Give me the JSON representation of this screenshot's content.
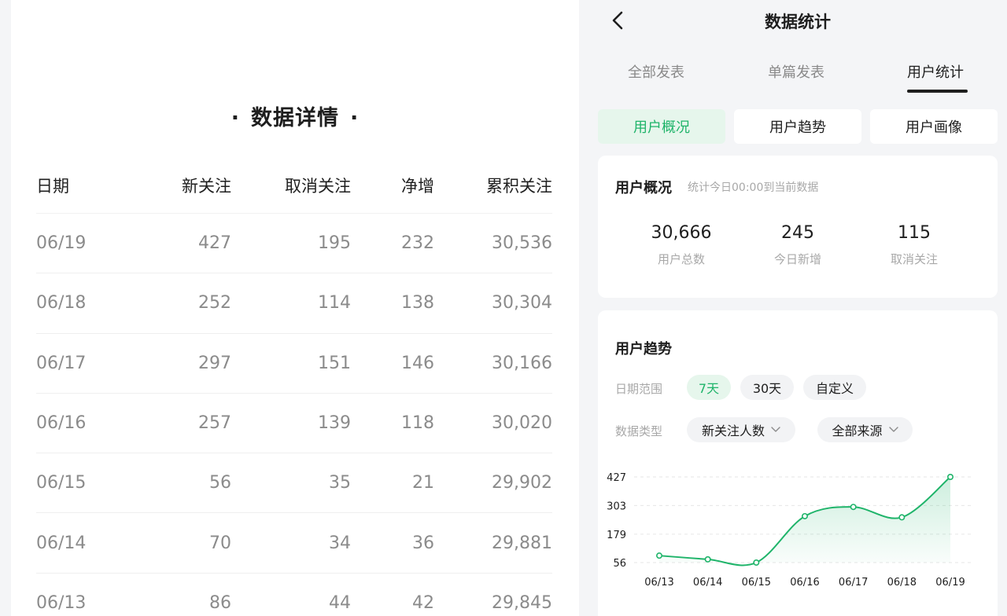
{
  "detail": {
    "title": "数据详情",
    "title_dot": "·",
    "columns": [
      "日期",
      "新关注",
      "取消关注",
      "净增",
      "累积关注"
    ],
    "rows": [
      [
        "06/19",
        "427",
        "195",
        "232",
        "30,536"
      ],
      [
        "06/18",
        "252",
        "114",
        "138",
        "30,304"
      ],
      [
        "06/17",
        "297",
        "151",
        "146",
        "30,166"
      ],
      [
        "06/16",
        "257",
        "139",
        "118",
        "30,020"
      ],
      [
        "06/15",
        "56",
        "35",
        "21",
        "29,902"
      ],
      [
        "06/14",
        "70",
        "34",
        "36",
        "29,881"
      ],
      [
        "06/13",
        "86",
        "44",
        "42",
        "29,845"
      ]
    ]
  },
  "stats": {
    "nav_title": "数据统计",
    "back_icon": "chevron-left-icon",
    "tabs": [
      {
        "label": "全部发表",
        "active": false
      },
      {
        "label": "单篇发表",
        "active": false
      },
      {
        "label": "用户统计",
        "active": true
      }
    ],
    "subtabs": [
      {
        "label": "用户概况",
        "active": true
      },
      {
        "label": "用户趋势",
        "active": false
      },
      {
        "label": "用户画像",
        "active": false
      }
    ],
    "overview": {
      "title": "用户概况",
      "hint": "统计今日00:00到当前数据",
      "items": [
        {
          "value": "30,666",
          "label": "用户总数"
        },
        {
          "value": "245",
          "label": "今日新增"
        },
        {
          "value": "115",
          "label": "取消关注"
        }
      ]
    },
    "trend": {
      "title": "用户趋势",
      "date_range_label": "日期范围",
      "date_options": [
        {
          "label": "7天",
          "active": true
        },
        {
          "label": "30天",
          "active": false
        },
        {
          "label": "自定义",
          "active": false
        }
      ],
      "data_type_label": "数据类型",
      "data_type_value": "新关注人数",
      "source_value": "全部来源",
      "dropdown_icon": "chevron-down-icon"
    },
    "accent_color": "#1fb46a",
    "accent_bg": "#e6f6ec"
  },
  "chart_data": {
    "type": "area",
    "categories": [
      "06/13",
      "06/14",
      "06/15",
      "06/16",
      "06/17",
      "06/18",
      "06/19"
    ],
    "values": [
      86,
      70,
      56,
      257,
      297,
      252,
      427
    ],
    "y_ticks": [
      56,
      179,
      303,
      427
    ],
    "ylim": [
      56,
      427
    ],
    "grid": true,
    "title": "",
    "xlabel": "",
    "ylabel": "",
    "color": "#1fb46a"
  }
}
